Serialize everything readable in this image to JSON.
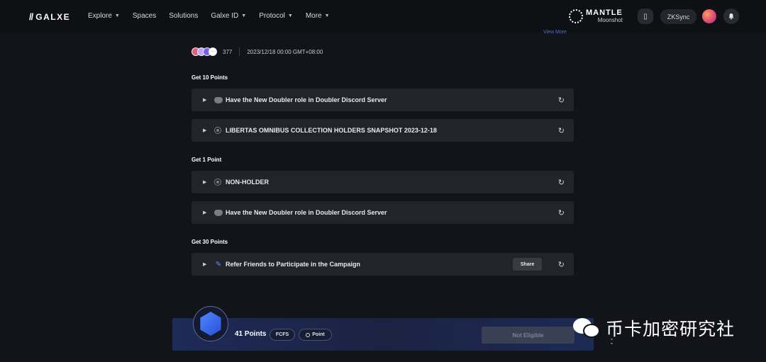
{
  "nav": {
    "logo_mark": "//",
    "logo_text": "GALXE",
    "links": [
      {
        "label": "Explore",
        "caret": true
      },
      {
        "label": "Spaces",
        "caret": false
      },
      {
        "label": "Solutions",
        "caret": false
      },
      {
        "label": "Galxe ID",
        "caret": true
      },
      {
        "label": "Protocol",
        "caret": true
      },
      {
        "label": "More",
        "caret": true
      }
    ],
    "promo_title": "MANTLE",
    "promo_sub": "Moonshot",
    "network": "ZKSync"
  },
  "campaign": {
    "view_more": "View More",
    "participants": "377",
    "date": "2023/12/18 00:00 GMT+08:00"
  },
  "sections": [
    {
      "heading": "Get 10 Points",
      "tasks": [
        {
          "label": "Have the New Doubler role in Doubler Discord Server",
          "icon": "discord-icon"
        },
        {
          "label": "LIBERTAS OMNIBUS COLLECTION HOLDERS SNAPSHOT 2023-12-18",
          "icon": "snapshot-icon"
        }
      ]
    },
    {
      "heading": "Get 1 Point",
      "tasks": [
        {
          "label": "NON-HOLDER",
          "icon": "snapshot-icon"
        },
        {
          "label": "Have the New Doubler role in Doubler Discord Server",
          "icon": "discord-icon"
        }
      ]
    },
    {
      "heading": "Get 30 Points",
      "tasks": [
        {
          "label": "Refer Friends to Participate in the Campaign",
          "icon": "refer-icon",
          "button": "Share"
        }
      ]
    }
  ],
  "bottom": {
    "points": "41 Points",
    "chip_fcfs": "FCFS",
    "chip_point": "Point",
    "status_button": "Not Eligible"
  },
  "watermark": {
    "text": "币卡加密研究社"
  }
}
